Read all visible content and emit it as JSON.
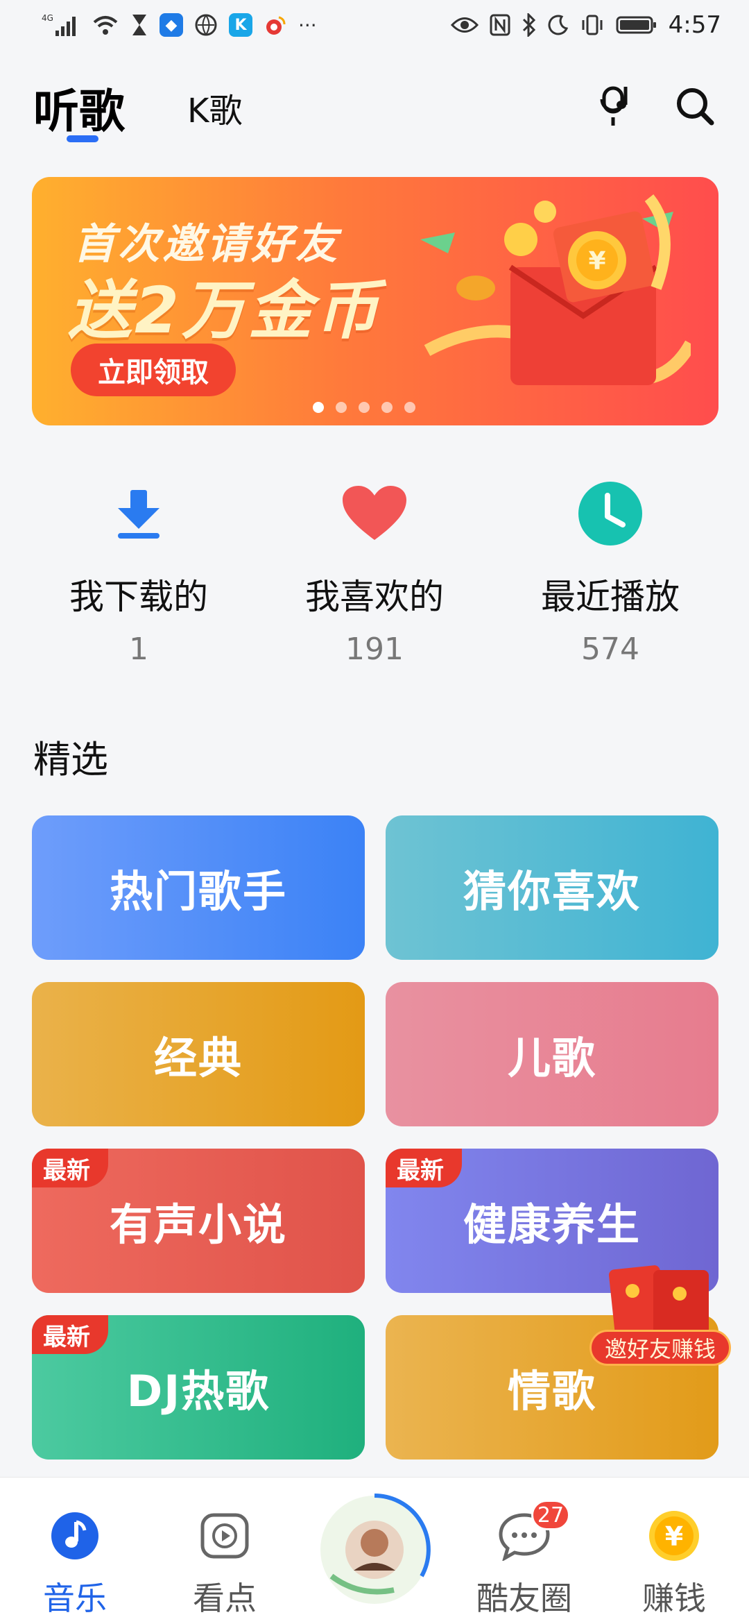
{
  "status_bar": {
    "network": "4G",
    "time": "4:57",
    "more": "···"
  },
  "header": {
    "tab_main": "听歌",
    "tab_k": "K歌"
  },
  "banner": {
    "line1": "首次邀请好友",
    "line2": "送2万金币",
    "cta": "立即领取",
    "slide_count": 5,
    "active_slide": 1
  },
  "quick": [
    {
      "label": "我下载的",
      "count": "1",
      "icon": "download-icon",
      "color": "#2a7bf0"
    },
    {
      "label": "我喜欢的",
      "count": "191",
      "icon": "heart-icon",
      "color": "#f25656"
    },
    {
      "label": "最近播放",
      "count": "574",
      "icon": "clock-icon",
      "color": "#17c2b0"
    }
  ],
  "section": {
    "title": "精选"
  },
  "tiles": [
    {
      "label": "热门歌手",
      "tag": "",
      "from": "#6e9dfb",
      "to": "#3b82f6"
    },
    {
      "label": "猜你喜欢",
      "tag": "",
      "from": "#6ec3d3",
      "to": "#3fb3d3"
    },
    {
      "label": "经典",
      "tag": "",
      "from": "#eab24a",
      "to": "#e39a15"
    },
    {
      "label": "儿歌",
      "tag": "",
      "from": "#e891a0",
      "to": "#e77c8e"
    },
    {
      "label": "有声小说",
      "tag": "最新",
      "from": "#ee6a5e",
      "to": "#e0534a"
    },
    {
      "label": "健康养生",
      "tag": "最新",
      "from": "#8186ee",
      "to": "#6f66d2"
    },
    {
      "label": "DJ热歌",
      "tag": "最新",
      "from": "#4ccaa0",
      "to": "#1fb07d"
    },
    {
      "label": "情歌",
      "tag": "",
      "from": "#ebb450",
      "to": "#e29b19"
    }
  ],
  "float_invite": {
    "label": "邀好友赚钱"
  },
  "bottom_nav": [
    {
      "label": "音乐",
      "icon": "music-note-icon",
      "active": true
    },
    {
      "label": "看点",
      "icon": "play-video-icon",
      "active": false
    },
    {
      "label": "酷友圈",
      "icon": "chat-bubble-icon",
      "active": false,
      "badge": "27"
    },
    {
      "label": "赚钱",
      "icon": "yuan-coin-icon",
      "active": false
    }
  ],
  "colors": {
    "accent": "#1f63e8",
    "badge": "#f0463b"
  }
}
